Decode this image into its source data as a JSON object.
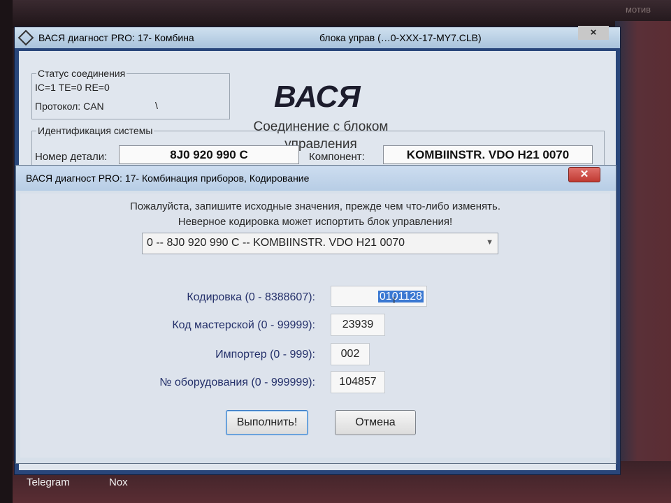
{
  "background_window": {
    "title": "ВАСЯ диагност PRO: 17- Комбина",
    "title_tail": "блока управ   (…0-XXX-17-MY7.CLB)",
    "close_label": "×",
    "connection_status": {
      "legend": "Статус соединения",
      "ic_te_re": "IC=1  TE=0  RE=0",
      "protocol": "Протокол: CAN",
      "mark": "\\"
    },
    "logo": "ВАСЯ",
    "subtitle": "Соединение с блоком управления",
    "identification": {
      "legend": "Идентификация системы",
      "part_label": "Номер детали:",
      "part_value": "8J0 920 990 C",
      "component_label": "Компонент:",
      "component_value": "KOMBIINSTR. VDO H21 0070"
    }
  },
  "dialog": {
    "title": "ВАСЯ диагност PRO: 17- Комбинация приборов,  Кодирование",
    "close_label": "✕",
    "warning_line1": "Пожалуйста, запишите исходные значения, прежде чем что-либо изменять.",
    "warning_line2": "Неверное кодировка может испортить блок управления!",
    "module_select": "0 -- 8J0 920 990 C -- KOMBIINSTR. VDO H21 0070",
    "fields": {
      "coding_label": "Кодировка (0 - 8388607):",
      "coding_value": "0101128",
      "workshop_label": "Код мастерской (0 - 99999):",
      "workshop_value": "23939",
      "importer_label": "Импортер (0 - 999):",
      "importer_value": "002",
      "equipment_label": "№ оборудования (0 - 999999):",
      "equipment_value": "104857"
    },
    "buttons": {
      "execute": "Выполнить!",
      "cancel": "Отмена"
    }
  },
  "desktop": {
    "corner_text": "мотив",
    "taskbar": [
      "Telegram",
      "Nox"
    ]
  }
}
